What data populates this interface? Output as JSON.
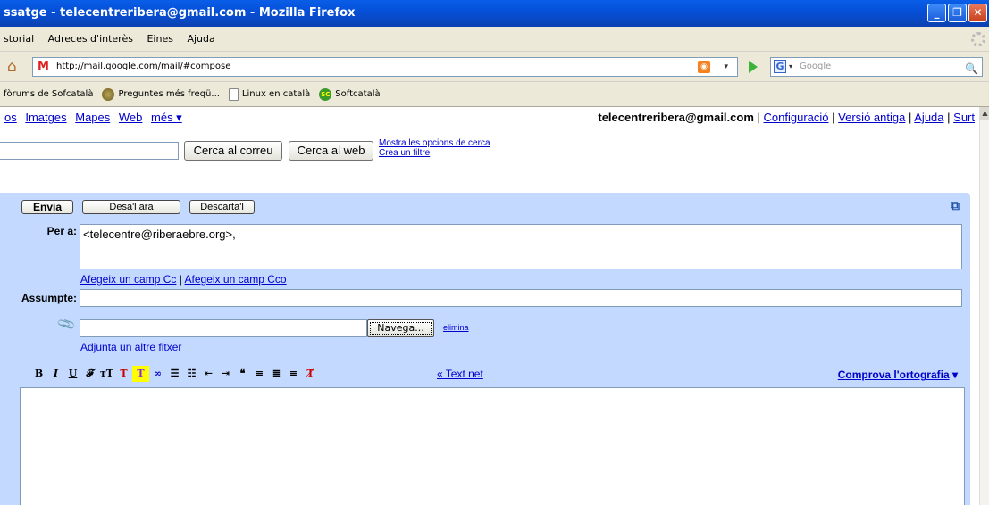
{
  "window": {
    "title": "ssatge - telecentreribera@gmail.com - Mozilla Firefox",
    "min_glyph": "_",
    "max_glyph": "❐",
    "close_glyph": "✕"
  },
  "menu": [
    "storial",
    "Adreces d'interès",
    "Eines",
    "Ajuda"
  ],
  "nav": {
    "url": "http://mail.google.com/mail/#compose",
    "search_placeholder": "Google",
    "rss_glyph": "◉",
    "drop_glyph": "▾",
    "home_glyph": "⌂",
    "search_glyph": "🔍",
    "g_glyph": "G",
    "gmail_glyph": "M"
  },
  "bookmarks": [
    "fòrums de Sofcatalà",
    "Preguntes més freqü...",
    "Linux en català",
    "Softcatalà"
  ],
  "top_nav": {
    "left": [
      "os",
      "Imatges",
      "Mapes",
      "Web",
      "més ▾"
    ],
    "user": "telecentreribera@gmail.com",
    "right": [
      "Configuració",
      "Versió antiga",
      "Ajuda",
      "Surt"
    ],
    "sep": "|"
  },
  "search": {
    "mail_button": "Cerca al correu",
    "web_button": "Cerca al web",
    "options_link": "Mostra les opcions de cerca",
    "filter_link": "Crea un filtre"
  },
  "compose": {
    "send": "Envia",
    "save": "Desa'l ara",
    "discard": "Descarta'l",
    "to_label": "Per a:",
    "to_value": "<telecentre@riberaebre.org>,",
    "add_cc": "Afegeix un camp Cc",
    "cc_sep": "|",
    "add_bcc": "Afegeix un camp Cco",
    "subject_label": "Assumpte:",
    "browse": "Navega...",
    "remove": "elimina",
    "attach_another": "Adjunta un altre fitxer",
    "plain_text": "« Text net",
    "spellcheck": "Comprova l'ortografia",
    "spellcheck_arrow": "▾",
    "popout_glyph": "⧉",
    "clip_glyph": "📎"
  },
  "format_toolbar": [
    "B",
    "I",
    "U",
    "𝓕",
    "тT",
    "T",
    "T",
    "∞",
    "☰",
    "☷",
    "⇤",
    "⇥",
    "❝",
    "≡",
    "≣",
    "≡",
    "T̸"
  ]
}
